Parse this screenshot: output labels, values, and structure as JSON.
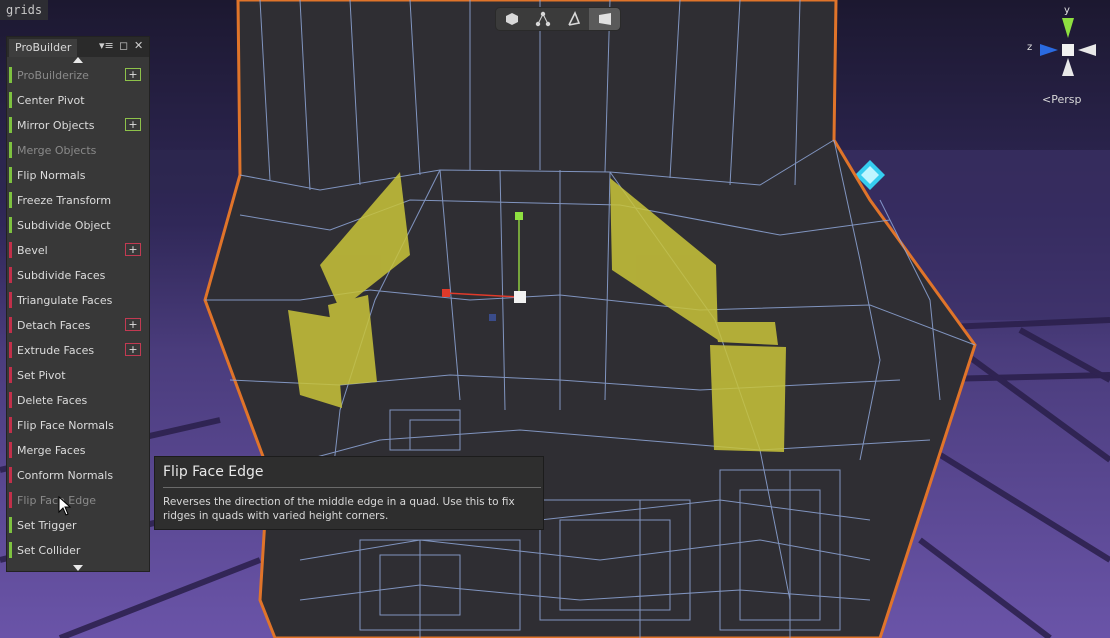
{
  "scene_tag": "grids",
  "toolbar": {
    "modes": [
      "object-mode-icon",
      "vertex-mode-icon",
      "edge-mode-icon",
      "face-mode-icon"
    ],
    "active_index": 3
  },
  "panel": {
    "title": "ProBuilder",
    "items": [
      {
        "label": "ProBuilderize",
        "color": "green",
        "disabled": true,
        "options": true
      },
      {
        "label": "Center Pivot",
        "color": "green",
        "disabled": false,
        "options": false
      },
      {
        "label": "Mirror Objects",
        "color": "green",
        "disabled": false,
        "options": true
      },
      {
        "label": "Merge Objects",
        "color": "green",
        "disabled": true,
        "options": false
      },
      {
        "label": "Flip Normals",
        "color": "green",
        "disabled": false,
        "options": false
      },
      {
        "label": "Freeze Transform",
        "color": "green",
        "disabled": false,
        "options": false
      },
      {
        "label": "Subdivide Object",
        "color": "green",
        "disabled": false,
        "options": false
      },
      {
        "label": "Bevel",
        "color": "red",
        "disabled": false,
        "options": true
      },
      {
        "label": "Subdivide Faces",
        "color": "red",
        "disabled": false,
        "options": false
      },
      {
        "label": "Triangulate Faces",
        "color": "red",
        "disabled": false,
        "options": false
      },
      {
        "label": "Detach Faces",
        "color": "red",
        "disabled": false,
        "options": true
      },
      {
        "label": "Extrude Faces",
        "color": "red",
        "disabled": false,
        "options": true
      },
      {
        "label": "Set Pivot",
        "color": "red",
        "disabled": false,
        "options": false
      },
      {
        "label": "Delete Faces",
        "color": "red",
        "disabled": false,
        "options": false
      },
      {
        "label": "Flip Face Normals",
        "color": "red",
        "disabled": false,
        "options": false
      },
      {
        "label": "Merge Faces",
        "color": "red",
        "disabled": false,
        "options": false
      },
      {
        "label": "Conform Normals",
        "color": "red",
        "disabled": false,
        "options": false
      },
      {
        "label": "Flip Face Edge",
        "color": "red",
        "disabled": true,
        "options": false
      },
      {
        "label": "Set Trigger",
        "color": "green",
        "disabled": false,
        "options": false
      },
      {
        "label": "Set Collider",
        "color": "green",
        "disabled": false,
        "options": false
      }
    ],
    "option_symbol": "+"
  },
  "tooltip": {
    "title": "Flip Face Edge",
    "description": "Reverses the direction of the middle edge in a quad.  Use this to fix ridges in quads with varied height corners."
  },
  "gizmo": {
    "y_label": "y",
    "z_label": "z",
    "projection": "Persp"
  },
  "colors": {
    "mesh_outline": "#e0742a",
    "wire": "#8fa6d8",
    "selected_face": "#c9c43a",
    "floor_grid": "#8f5fd0",
    "sky": "#1e1a33"
  }
}
